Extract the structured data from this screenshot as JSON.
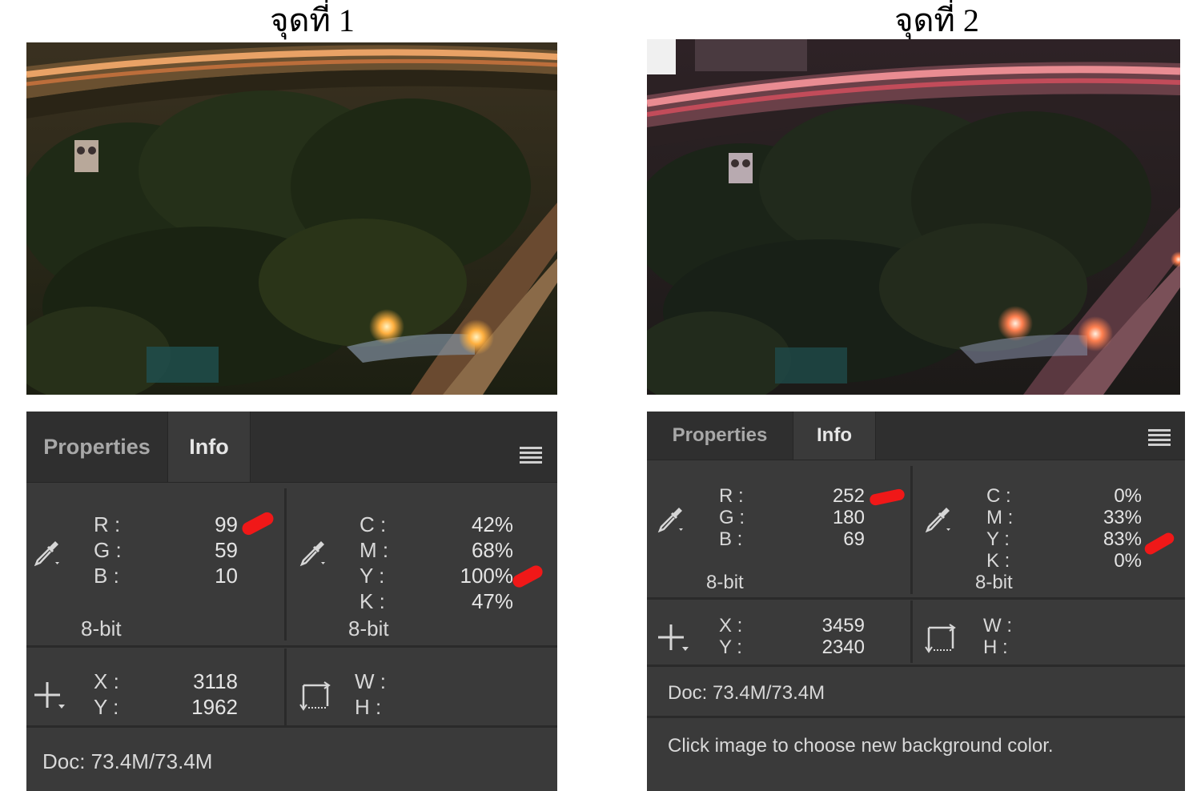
{
  "captions": [
    "จุดที่ 1",
    "จุดที่ 2"
  ],
  "panels": [
    {
      "tabs": {
        "properties": "Properties",
        "info": "Info"
      },
      "rgb": {
        "labels": [
          "R :",
          "G :",
          "B :"
        ],
        "values": [
          "99",
          "59",
          "10"
        ],
        "bitdepth": "8-bit"
      },
      "cmyk": {
        "labels": [
          "C :",
          "M :",
          "Y :",
          "K :"
        ],
        "values": [
          "42%",
          "68%",
          "100%",
          "47%"
        ],
        "bitdepth": "8-bit"
      },
      "xy": {
        "labels": [
          "X :",
          "Y :"
        ],
        "values": [
          "3118",
          "1962"
        ]
      },
      "wh": {
        "labels": [
          "W :",
          "H :"
        ]
      },
      "doc": "Doc: 73.4M/73.4M"
    },
    {
      "tabs": {
        "properties": "Properties",
        "info": "Info"
      },
      "rgb": {
        "labels": [
          "R :",
          "G :",
          "B :"
        ],
        "values": [
          "252",
          "180",
          "69"
        ],
        "bitdepth": "8-bit"
      },
      "cmyk": {
        "labels": [
          "C :",
          "M :",
          "Y :",
          "K :"
        ],
        "values": [
          "0%",
          "33%",
          "83%",
          "0%"
        ],
        "bitdepth": "8-bit"
      },
      "xy": {
        "labels": [
          "X :",
          "Y :"
        ],
        "values": [
          "3459",
          "2340"
        ]
      },
      "wh": {
        "labels": [
          "W :",
          "H :"
        ]
      },
      "doc": "Doc: 73.4M/73.4M",
      "hint": "Click image to choose new background color."
    }
  ],
  "icons": [
    "eyedropper-icon",
    "crosshair-icon",
    "selection-size-icon",
    "panel-menu-icon"
  ],
  "colors": {
    "panel_bg": "#3a3a3a",
    "tabbar_bg": "#2f2f2f",
    "divider": "#2a2a2a",
    "annotation": "#f01818"
  }
}
